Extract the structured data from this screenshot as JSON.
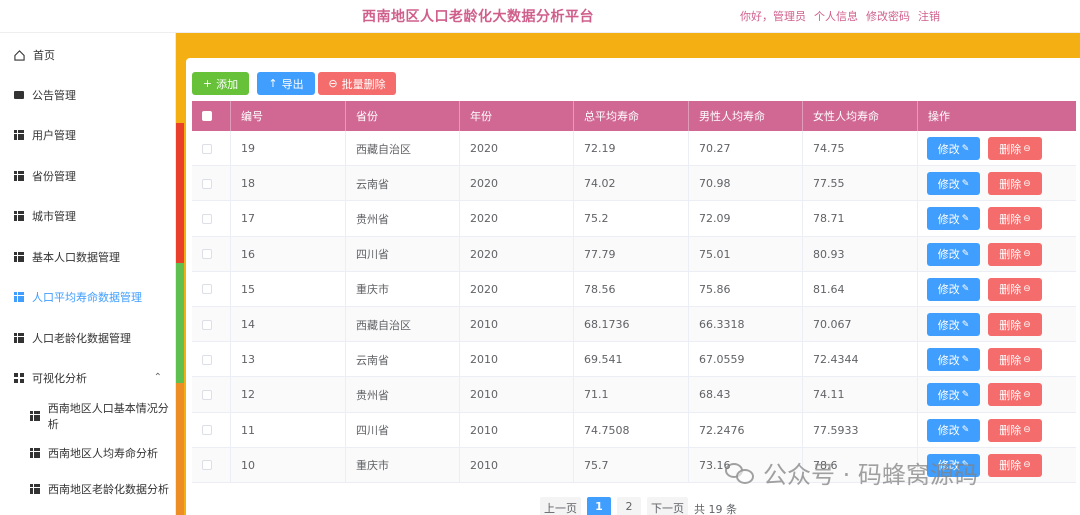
{
  "header": {
    "title": "西南地区人口老龄化大数据分析平台",
    "greeting": "你好，管理员",
    "links": [
      "个人信息",
      "修改密码",
      "注销"
    ]
  },
  "sidebar": {
    "items": [
      {
        "label": "首页",
        "icon": "home-icon"
      },
      {
        "label": "公告管理",
        "icon": "chat-icon"
      },
      {
        "label": "用户管理",
        "icon": "grid-icon"
      },
      {
        "label": "省份管理",
        "icon": "grid-icon"
      },
      {
        "label": "城市管理",
        "icon": "grid-icon"
      },
      {
        "label": "基本人口数据管理",
        "icon": "grid-icon"
      },
      {
        "label": "人口平均寿命数据管理",
        "icon": "grid-icon",
        "active": true
      },
      {
        "label": "人口老龄化数据管理",
        "icon": "grid-icon"
      },
      {
        "label": "可视化分析",
        "icon": "quad-icon",
        "expanded": true
      },
      {
        "label": "西南地区人口基本情况分析",
        "icon": "grid-icon",
        "sub": true
      },
      {
        "label": "西南地区人均寿命分析",
        "icon": "grid-icon",
        "sub": true
      },
      {
        "label": "西南地区老龄化数据分析",
        "icon": "grid-icon",
        "sub": true
      }
    ]
  },
  "toolbar": {
    "add_label": "添加",
    "export_label": "导出",
    "batch_delete_label": "批量删除"
  },
  "table": {
    "columns": [
      "编号",
      "省份",
      "年份",
      "总平均寿命",
      "男性人均寿命",
      "女性人均寿命",
      "操作"
    ],
    "edit_label": "修改",
    "delete_label": "删除",
    "rows": [
      [
        "19",
        "西藏自治区",
        "2020",
        "72.19",
        "70.27",
        "74.75"
      ],
      [
        "18",
        "云南省",
        "2020",
        "74.02",
        "70.98",
        "77.55"
      ],
      [
        "17",
        "贵州省",
        "2020",
        "75.2",
        "72.09",
        "78.71"
      ],
      [
        "16",
        "四川省",
        "2020",
        "77.79",
        "75.01",
        "80.93"
      ],
      [
        "15",
        "重庆市",
        "2020",
        "78.56",
        "75.86",
        "81.64"
      ],
      [
        "14",
        "西藏自治区",
        "2010",
        "68.1736",
        "66.3318",
        "70.067"
      ],
      [
        "13",
        "云南省",
        "2010",
        "69.541",
        "67.0559",
        "72.4344"
      ],
      [
        "12",
        "贵州省",
        "2010",
        "71.1",
        "68.43",
        "74.11"
      ],
      [
        "11",
        "四川省",
        "2010",
        "74.7508",
        "72.2476",
        "77.5933"
      ],
      [
        "10",
        "重庆市",
        "2010",
        "75.7",
        "73.16",
        "78.6"
      ]
    ]
  },
  "pagination": {
    "prev_label": "上一页",
    "pages": [
      "1",
      "2"
    ],
    "current": "1",
    "next_label": "下一页",
    "total_label": "共 19 条"
  },
  "watermark": {
    "text": "公众号 · 码蜂窝源码"
  },
  "colors": {
    "brand": "#d05f8c",
    "table_header": "#d06893",
    "primary": "#409eff",
    "success": "#67c23a",
    "danger": "#f56c6c",
    "background": "#f4b012"
  }
}
